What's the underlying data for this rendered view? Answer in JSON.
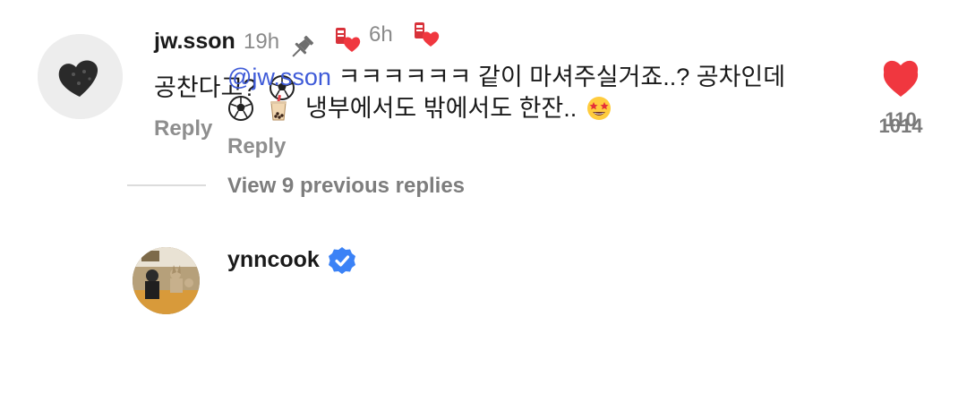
{
  "comments": [
    {
      "username": "jw.sson",
      "time": "19h",
      "pinned": true,
      "text": "공찬다고?",
      "emoji_after_text": [
        "soccer-ball"
      ],
      "reply_label": "Reply",
      "like_count": "1014",
      "liked": true
    },
    {
      "username": "ynncook",
      "verified": true,
      "time": "6h",
      "mention": "@jw.sson",
      "line1_text": "ㅋㅋㅋㅋㅋㅋ 같이 마셔주실거죠..? 공차인데",
      "line2_text": "냉부에서도 밖에서도 한잔..",
      "line2_emoji_before": [
        "soccer-ball",
        "bubble-tea"
      ],
      "line2_emoji_after": [
        "star-struck-face"
      ],
      "reply_label": "Reply",
      "like_count": "110",
      "liked": true
    }
  ],
  "view_replies_label": "View 9 previous replies",
  "colors": {
    "heart": "#f0373f",
    "mention": "#3f5bd8",
    "verified": "#3b82f6",
    "muted": "#8e8e8e"
  }
}
